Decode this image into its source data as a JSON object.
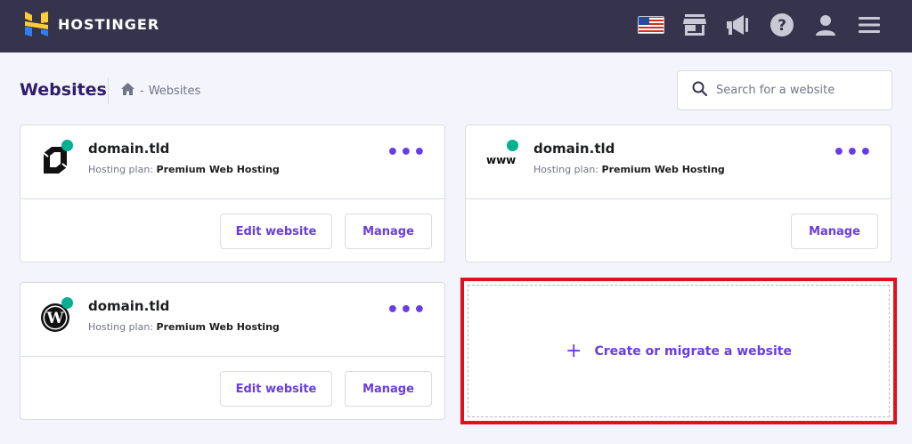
{
  "brand": {
    "name": "HOSTINGER",
    "colors": {
      "topbar": "#36344d",
      "accent": "#673de6",
      "status": "#00b090",
      "highlight": "#e0111c"
    }
  },
  "topbar": {
    "icons": [
      "us-flag-icon",
      "store-icon",
      "megaphone-icon",
      "help-icon",
      "user-icon",
      "menu-icon"
    ]
  },
  "page": {
    "title": "Websites"
  },
  "breadcrumb": {
    "home_icon": "home-icon",
    "separator": "-",
    "current": "Websites"
  },
  "search": {
    "placeholder": "Search for a website",
    "value": ""
  },
  "cards": [
    {
      "icon": "custom-logo-icon",
      "domain": "domain.tld",
      "plan_label": "Hosting plan:",
      "plan": "Premium Web Hosting",
      "edit_label": "Edit website",
      "manage_label": "Manage"
    },
    {
      "icon": "www-icon",
      "icon_text": "www",
      "domain": "domain.tld",
      "plan_label": "Hosting plan:",
      "plan": "Premium Web Hosting",
      "manage_label": "Manage"
    },
    {
      "icon": "wordpress-icon",
      "domain": "domain.tld",
      "plan_label": "Hosting plan:",
      "plan": "Premium Web Hosting",
      "edit_label": "Edit website",
      "manage_label": "Manage"
    }
  ],
  "create": {
    "plus": "+",
    "label": "Create or migrate a website"
  }
}
